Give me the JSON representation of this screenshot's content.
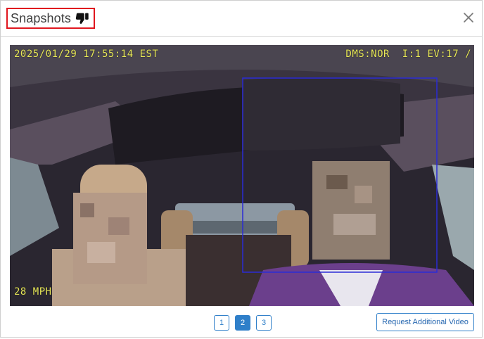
{
  "dialog": {
    "title": "Snapshots",
    "feedback_icon": "thumbs-down-icon",
    "close_icon": "close-icon"
  },
  "snapshot": {
    "timestamp": "2025/01/29 17:55:14 EST",
    "status": "DMS:NOR  I:1 EV:17 /",
    "speed": "28 MPH",
    "detection_box_color": "#2b2bd6"
  },
  "pagination": {
    "pages": [
      "1",
      "2",
      "3"
    ],
    "active_page": "2"
  },
  "actions": {
    "request_video_label": "Request Additional Video"
  },
  "colors": {
    "accent": "#2f7fc9",
    "highlight_border": "#e0161e"
  }
}
